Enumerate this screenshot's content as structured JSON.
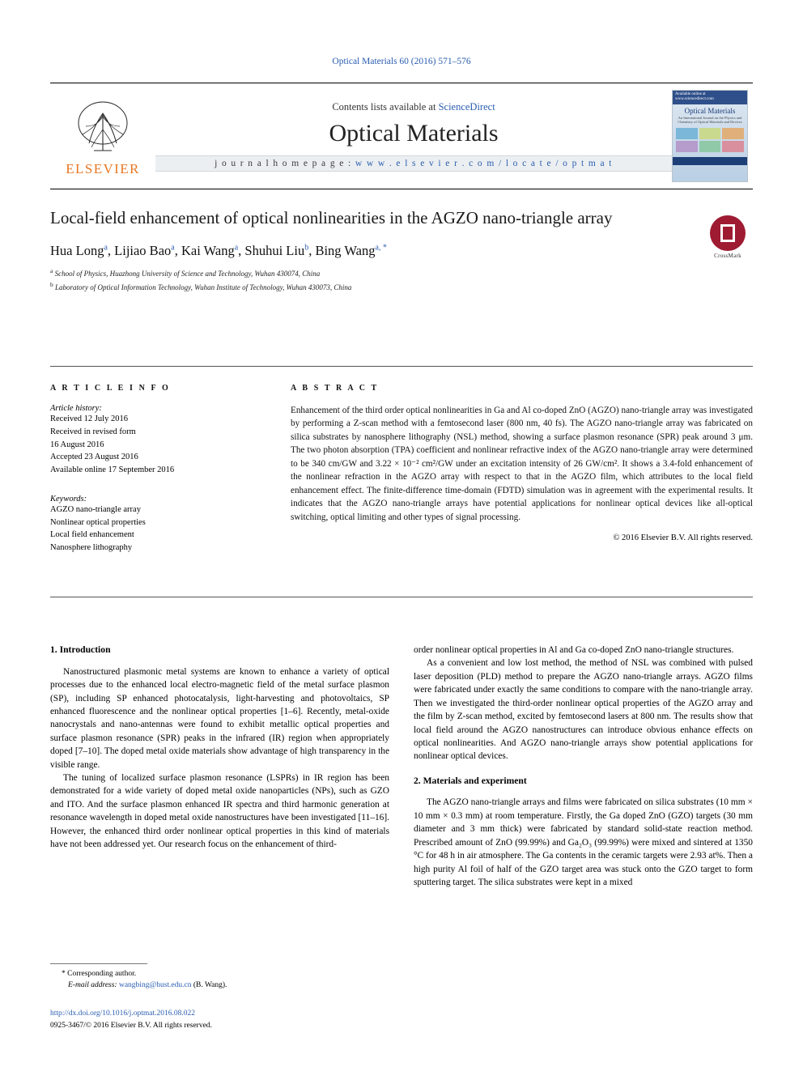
{
  "journal_ref": "Optical Materials 60 (2016) 571–576",
  "masthead": {
    "publisher": "ELSEVIER",
    "contents_prefix": "Contents lists available at",
    "contents_link": "ScienceDirect",
    "journal_title": "Optical Materials",
    "homepage_prefix": "j o u r n a l   h o m e p a g e :",
    "homepage_url": "w w w . e l s e v i e r . c o m / l o c a t e / o p t m a t",
    "cover": {
      "top_note": "Available online at www.sciencedirect.com",
      "title": "Optical Materials",
      "subtitle": "An International Journal on the Physics and Chemistry of Optical Materials and Devices"
    }
  },
  "article": {
    "title": "Local-field enhancement of optical nonlinearities in the AGZO nano-triangle array",
    "crossmark_label": "CrossMark",
    "authors": "Hua Long a, Lijiao Bao a, Kai Wang a, Shuhui Liu b, Bing Wang a, *",
    "authors_parts": [
      {
        "name": "Hua Long",
        "sup": "a"
      },
      {
        "name": "Lijiao Bao",
        "sup": "a"
      },
      {
        "name": "Kai Wang",
        "sup": "a"
      },
      {
        "name": "Shuhui Liu",
        "sup": "b"
      },
      {
        "name": "Bing Wang",
        "sup": "a, *"
      }
    ],
    "affiliations": [
      {
        "sup": "a",
        "text": "School of Physics, Huazhong University of Science and Technology, Wuhan 430074, China"
      },
      {
        "sup": "b",
        "text": "Laboratory of Optical Information Technology, Wuhan Institute of Technology, Wuhan 430073, China"
      }
    ]
  },
  "article_info": {
    "heading": "A R T I C L E   I N F O",
    "history_title": "Article history:",
    "history_lines": [
      "Received 12 July 2016",
      "Received in revised form",
      "16 August 2016",
      "Accepted 23 August 2016",
      "Available online 17 September 2016"
    ],
    "keywords_title": "Keywords:",
    "keywords": [
      "AGZO nano-triangle array",
      "Nonlinear optical properties",
      "Local field enhancement",
      "Nanosphere lithography"
    ]
  },
  "abstract": {
    "heading": "A B S T R A C T",
    "text": "Enhancement of the third order optical nonlinearities in Ga and Al co-doped ZnO (AGZO) nano-triangle array was investigated by performing a Z-scan method with a femtosecond laser (800 nm, 40 fs). The AGZO nano-triangle array was fabricated on silica substrates by nanosphere lithography (NSL) method, showing a surface plasmon resonance (SPR) peak around 3 μm. The two photon absorption (TPA) coefficient and nonlinear refractive index of the AGZO nano-triangle array were determined to be 340 cm/GW and 3.22 × 10⁻² cm²/GW under an excitation intensity of 26 GW/cm². It shows a 3.4-fold enhancement of the nonlinear refraction in the AGZO array with respect to that in the AGZO film, which attributes to the local field enhancement effect. The finite-difference time-domain (FDTD) simulation was in agreement with the experimental results. It indicates that the AGZO nano-triangle arrays have potential applications for nonlinear optical devices like all-optical switching, optical limiting and other types of signal processing.",
    "copyright": "© 2016 Elsevier B.V. All rights reserved."
  },
  "body": {
    "left": {
      "section_heading": "1.  Introduction",
      "paragraphs": [
        "Nanostructured plasmonic metal systems are known to enhance a variety of optical processes due to the enhanced local electro-magnetic field of the metal surface plasmon (SP), including SP enhanced photocatalysis, light-harvesting and photovoltaics, SP enhanced fluorescence and the nonlinear optical properties [1–6]. Recently, metal-oxide nanocrystals and nano-antennas were found to exhibit metallic optical properties and surface plasmon resonance (SPR) peaks in the infrared (IR) region when appropriately doped [7–10]. The doped metal oxide materials show advantage of high transparency in the visible range.",
        "The tuning of localized surface plasmon resonance (LSPRs) in IR region has been demonstrated for a wide variety of doped metal oxide nanoparticles (NPs), such as GZO and ITO. And the surface plasmon enhanced IR spectra and third harmonic generation at resonance wavelength in doped metal oxide nanostructures have been investigated [11–16]. However, the enhanced third order nonlinear optical properties in this kind of materials have not been addressed yet. Our research focus on the enhancement of third-"
      ]
    },
    "right": {
      "paragraphs_before_heading": [
        "order nonlinear optical properties in Al and Ga co-doped ZnO nano-triangle structures.",
        "As a convenient and low lost method, the method of NSL was combined with pulsed laser deposition (PLD) method to prepare the AGZO nano-triangle arrays. AGZO films were fabricated under exactly the same conditions to compare with the nano-triangle array. Then we investigated the third-order nonlinear optical properties of the AGZO array and the film by Z-scan method, excited by femtosecond lasers at 800 nm. The results show that local field around the AGZO nanostructures can introduce obvious enhance effects on optical nonlinearities. And AGZO nano-triangle arrays show potential applications for nonlinear optical devices."
      ],
      "section_heading": "2.  Materials and experiment",
      "paragraphs_after_heading": [
        "The AGZO nano-triangle arrays and films were fabricated on silica substrates (10 mm × 10 mm × 0.3 mm) at room temperature. Firstly, the Ga doped ZnO (GZO) targets (30 mm diameter and 3 mm thick) were fabricated by standard solid-state reaction method. Prescribed amount of ZnO (99.99%) and Ga₂O₃ (99.99%) were mixed and sintered at 1350 °C for 48 h in air atmosphere. The Ga contents in the ceramic targets were 2.93 at%. Then a high purity Al foil of half of the GZO target area was stuck onto the GZO target to form sputtering target. The silica substrates were kept in a mixed"
      ]
    }
  },
  "footnote": {
    "corresponding_marker": "*",
    "corresponding_label": "Corresponding author.",
    "email_label": "E-mail address:",
    "email": "wangbing@hust.edu.cn",
    "email_owner": "(B. Wang)."
  },
  "doi": {
    "url": "http://dx.doi.org/10.1016/j.optmat.2016.08.022",
    "issn_line": "0925-3467/© 2016 Elsevier B.V. All rights reserved."
  },
  "colors": {
    "link": "#2a5db0",
    "elsevier_orange": "#e87722",
    "crossmark_red": "#9e1b32"
  }
}
